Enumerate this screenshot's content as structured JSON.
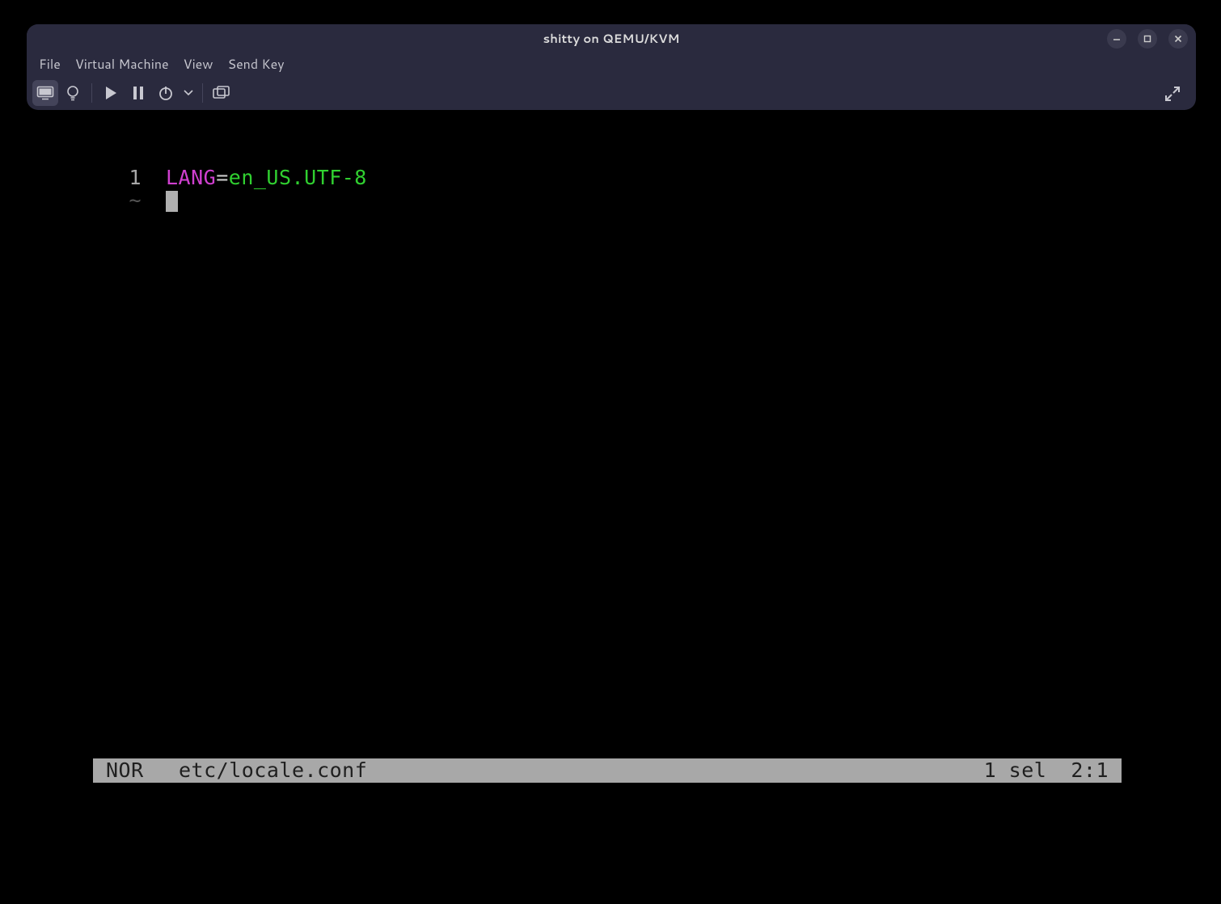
{
  "window": {
    "title": "shitty on QEMU/KVM",
    "controls": {
      "minimize": "minimize",
      "maximize": "maximize",
      "close": "close"
    }
  },
  "menubar": {
    "items": [
      "File",
      "Virtual Machine",
      "View",
      "Send Key"
    ]
  },
  "toolbar": {
    "icons": {
      "console": "monitor-icon",
      "details": "lightbulb-icon",
      "run": "play-icon",
      "pause": "pause-icon",
      "shutdown": "power-icon",
      "shutdown_menu": "chevron-down-icon",
      "snapshots": "snapshots-icon",
      "fullscreen": "fullscreen-icon"
    }
  },
  "editor": {
    "line_number": "1",
    "tilde": "~",
    "content": {
      "key": "LANG",
      "eq": "=",
      "value": "en_US.UTF-8"
    }
  },
  "statusbar": {
    "mode": "NOR",
    "file": "etc/locale.conf",
    "selection": "1 sel",
    "position": "2:1"
  }
}
